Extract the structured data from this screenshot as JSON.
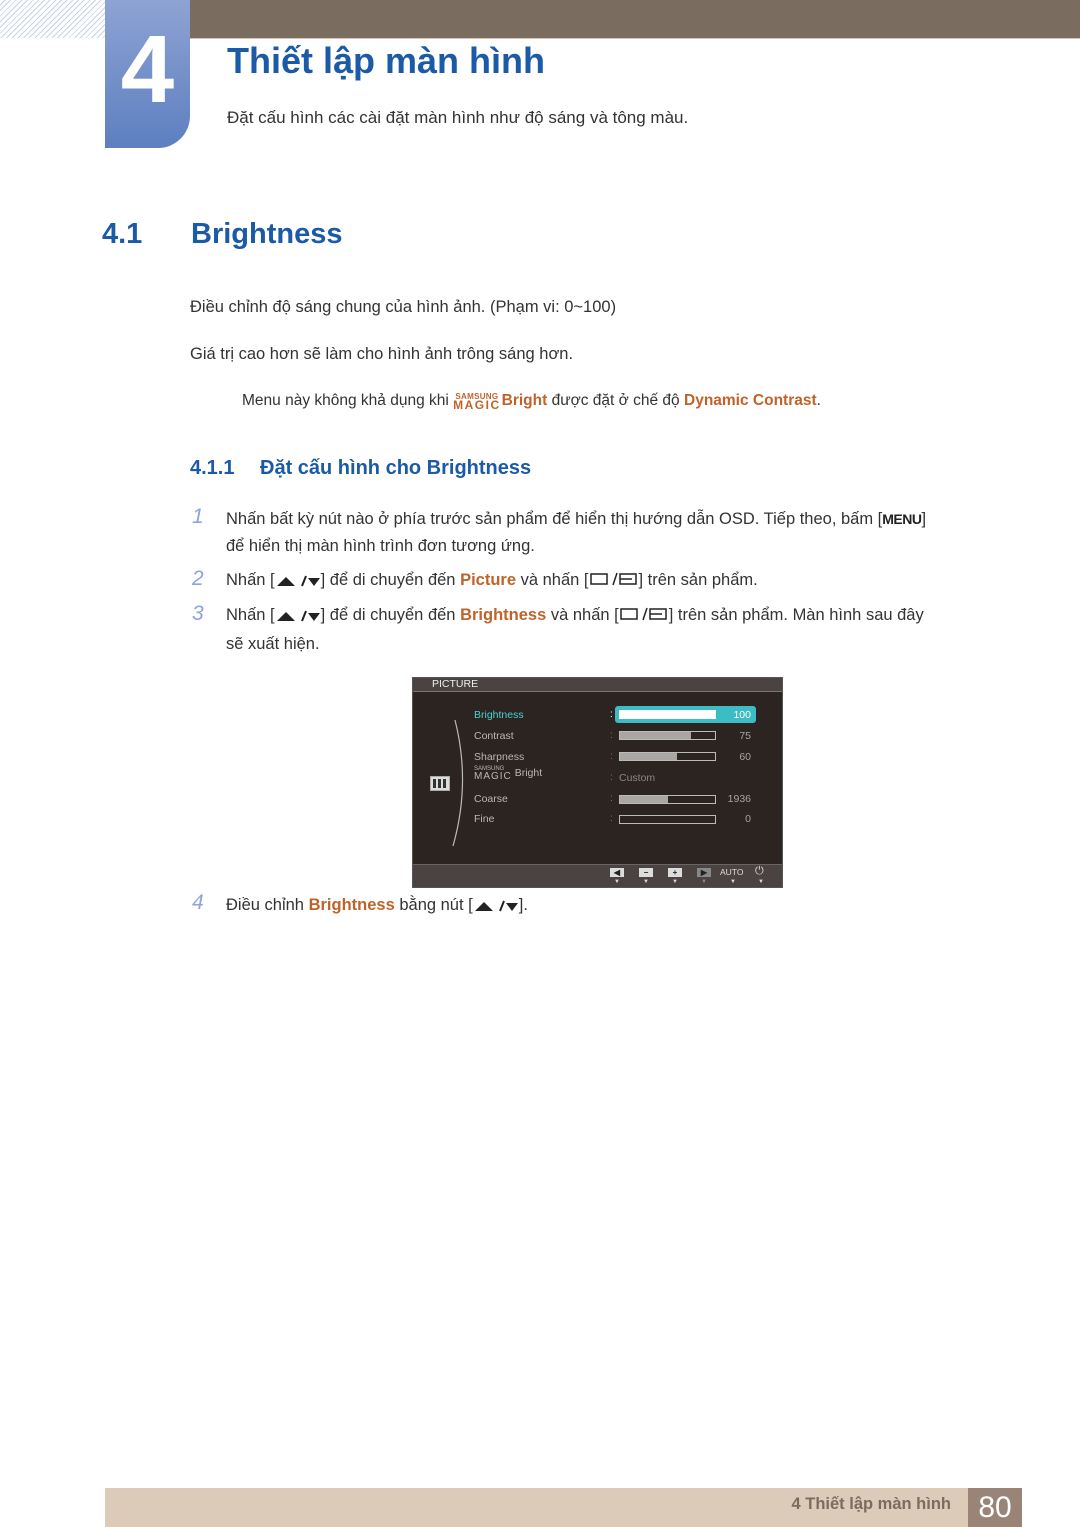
{
  "chapter": {
    "number": "4",
    "title": "Thiết lập màn hình",
    "description": "Đặt cấu hình các cài đặt màn hình như độ sáng và tông màu."
  },
  "section": {
    "number": "4.1",
    "title": "Brightness"
  },
  "paragraphs": [
    "Điều chỉnh độ sáng chung của hình ảnh. (Phạm vi: 0~100)",
    "Giá trị cao hơn sẽ làm cho hình ảnh trông sáng hơn."
  ],
  "note": {
    "prefix": "Menu này không khả dụng khi",
    "magic_small": "SAMSUNG",
    "magic_big": "MAGIC",
    "magic_word": "Bright",
    "middle": "được đặt ở chế độ",
    "mode": "Dynamic Contrast",
    "suffix": "."
  },
  "subsection": {
    "number": "4.1.1",
    "title": "Đặt cấu hình cho Brightness"
  },
  "steps": [
    {
      "num": "1",
      "line1": "Nhấn bất kỳ nút nào ở phía trước sản phẩm để hiển thị hướng dẫn OSD. Tiếp theo, bấm [",
      "key": "MENU",
      "line1_end": "]",
      "line2": "để hiển thị màn hình trình đơn tương ứng."
    },
    {
      "num": "2",
      "pre": "Nhấn [",
      "mid1": "] để di chuyển đến",
      "target": "Picture",
      "mid2": "và nhấn [",
      "post": "] trên sản phẩm."
    },
    {
      "num": "3",
      "pre": "Nhấn [",
      "mid1": "] để di chuyển đến",
      "target": "Brightness",
      "mid2": "và nhấn [",
      "post": "] trên sản phẩm. Màn hình sau đây",
      "line2": "sẽ xuất hiện."
    },
    {
      "num": "4",
      "pre": "Điều chỉnh",
      "target": "Brightness",
      "mid": "bằng nút [",
      "post": "]."
    }
  ],
  "osd": {
    "header": "PICTURE",
    "items": [
      {
        "label": "Brightness",
        "value": "100",
        "fraction": 1.0,
        "active": true
      },
      {
        "label": "Contrast",
        "value": "75",
        "fraction": 0.75
      },
      {
        "label": "Sharpness",
        "value": "60",
        "fraction": 0.6
      },
      {
        "label_small": "SAMSUNG",
        "label_big": "MAGIC",
        "label": "Bright",
        "value": "Custom"
      },
      {
        "label": "Coarse",
        "value": "1936",
        "fraction": 0.5
      },
      {
        "label": "Fine",
        "value": "0",
        "fraction": 0.0
      }
    ],
    "buttons": [
      "left-icon",
      "minus-icon",
      "plus-icon",
      "enter-icon",
      "AUTO",
      "power-icon"
    ]
  },
  "footer": {
    "chapter_label": "4 Thiết lập màn hình",
    "page": "80"
  },
  "colors": {
    "heading_blue": "#1b5aa6",
    "accent_orange": "#c0632a",
    "topbar": "#7a6d60",
    "osd_highlight": "#3cbcc4"
  }
}
